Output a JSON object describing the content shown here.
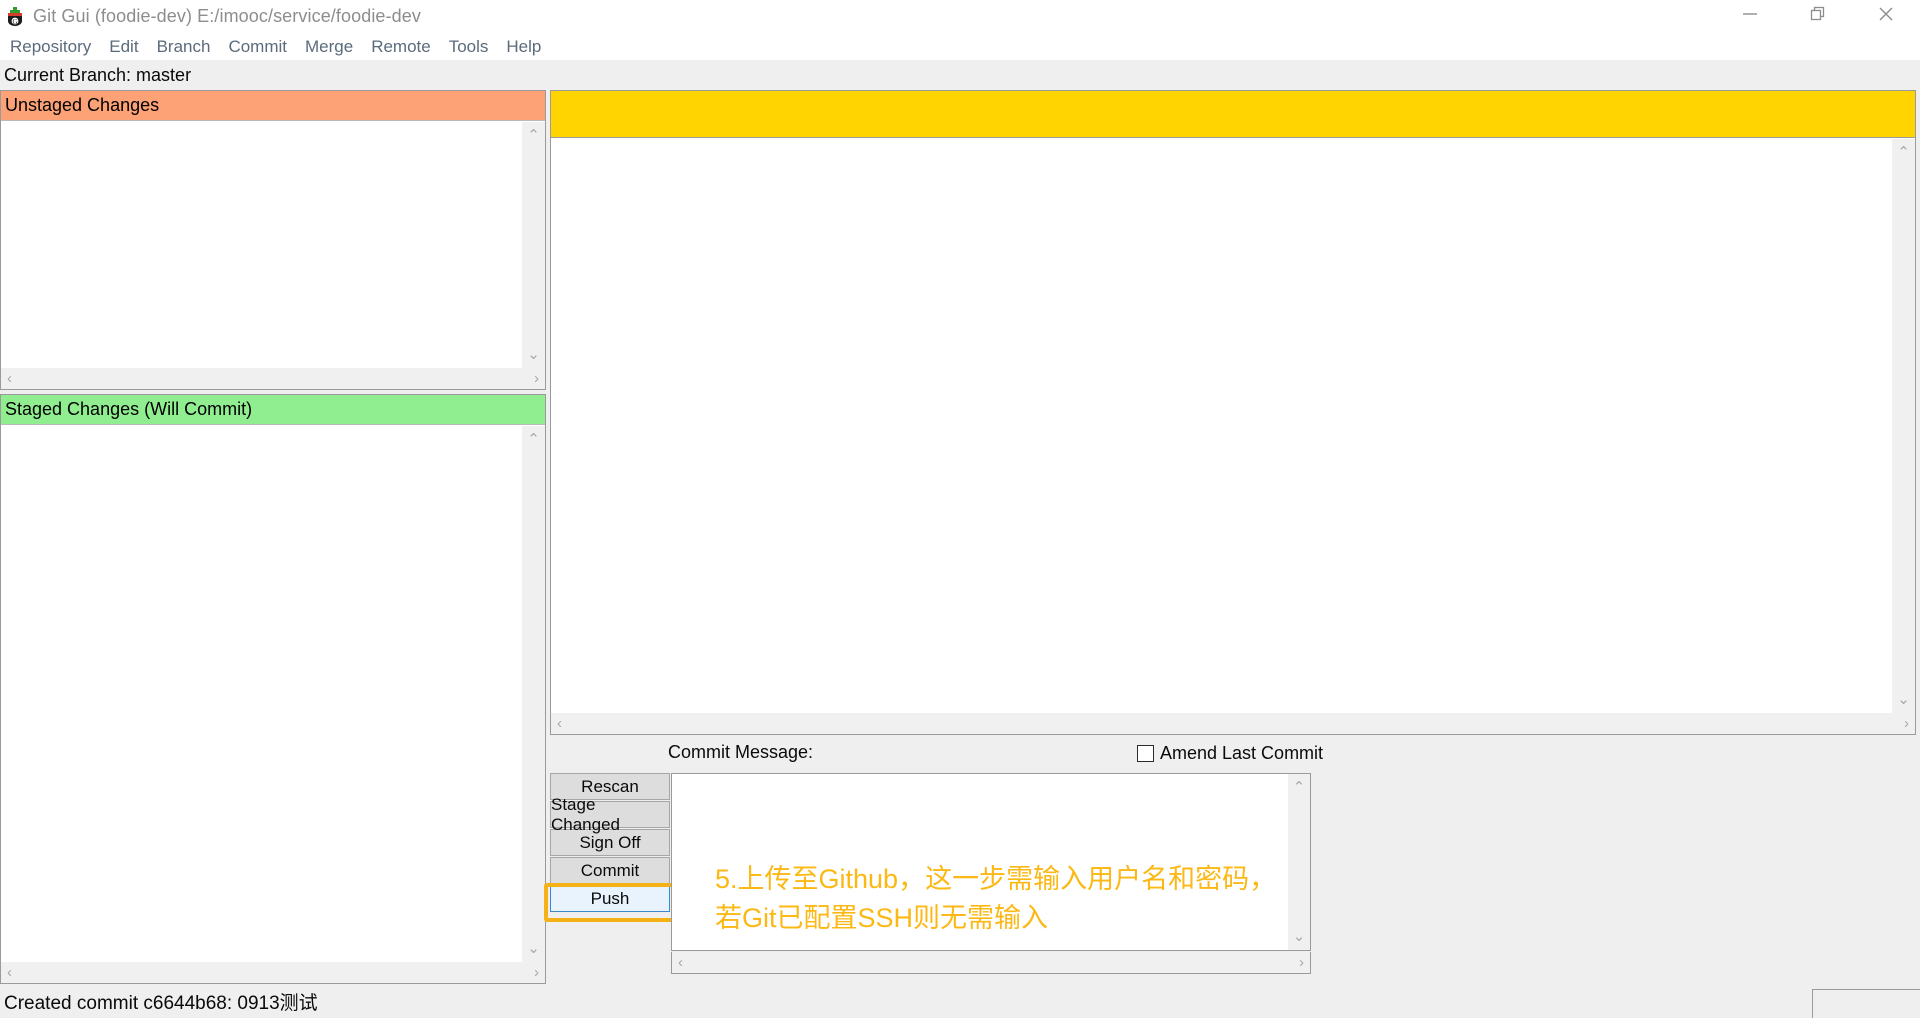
{
  "window": {
    "title": "Git Gui (foodie-dev) E:/imooc/service/foodie-dev",
    "icon": "git-gui-logo-icon",
    "controls": {
      "minimize": "minimize-icon",
      "restore": "restore-icon",
      "close": "close-icon"
    }
  },
  "menubar": {
    "items": [
      {
        "label": "Repository"
      },
      {
        "label": "Edit"
      },
      {
        "label": "Branch"
      },
      {
        "label": "Commit"
      },
      {
        "label": "Merge"
      },
      {
        "label": "Remote"
      },
      {
        "label": "Tools"
      },
      {
        "label": "Help"
      }
    ]
  },
  "branch_bar": {
    "label": "Current Branch: master"
  },
  "panels": {
    "unstaged": {
      "header": "Unstaged Changes",
      "header_color": "#fda276",
      "items": []
    },
    "staged": {
      "header": "Staged Changes (Will Commit)",
      "header_color": "#90ee90",
      "items": []
    }
  },
  "diff_view": {
    "banner_color": "#ffd400",
    "banner_text": "",
    "content": ""
  },
  "commit": {
    "message_label": "Commit Message:",
    "amend_label": "Amend Last Commit",
    "amend_checked": false,
    "message_value": "",
    "message_placeholder": "",
    "buttons": [
      {
        "label": "Rescan",
        "name": "rescan-button",
        "active": false
      },
      {
        "label": "Stage Changed",
        "name": "stage-changed-button",
        "active": false
      },
      {
        "label": "Sign Off",
        "name": "sign-off-button",
        "active": false
      },
      {
        "label": "Commit",
        "name": "commit-button",
        "active": false
      },
      {
        "label": "Push",
        "name": "push-button",
        "active": true
      }
    ]
  },
  "annotation": {
    "text": "5.上传至Github，这一步需输入用户名和密码，\n若Git已配置SSH则无需输入",
    "color": "#fcb814"
  },
  "statusbar": {
    "text": "Created commit c6644b68: 0913测试"
  },
  "icons": {
    "chevron_up": "⌃",
    "chevron_down": "⌄",
    "chevron_left": "‹",
    "chevron_right": "›"
  }
}
